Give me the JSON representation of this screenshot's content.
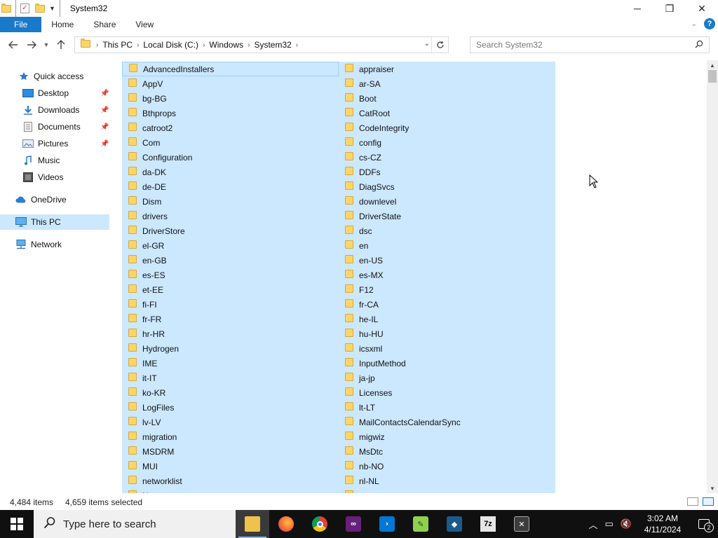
{
  "window": {
    "title": "System32",
    "controls": {
      "minimize": "─",
      "maximize": "❐",
      "close": "✕"
    }
  },
  "ribbon": {
    "tabs": [
      "File",
      "Home",
      "Share",
      "View"
    ]
  },
  "address": {
    "crumbs": [
      "This PC",
      "Local Disk (C:)",
      "Windows",
      "System32"
    ],
    "search_placeholder": "Search System32"
  },
  "nav": {
    "items": [
      {
        "label": "Quick access",
        "icon": "star-icon",
        "pinned": false
      },
      {
        "label": "Desktop",
        "icon": "desktop-icon",
        "pinned": true
      },
      {
        "label": "Downloads",
        "icon": "download-icon",
        "pinned": true
      },
      {
        "label": "Documents",
        "icon": "documents-icon",
        "pinned": true
      },
      {
        "label": "Pictures",
        "icon": "pictures-icon",
        "pinned": true
      },
      {
        "label": "Music",
        "icon": "music-icon",
        "pinned": false
      },
      {
        "label": "Videos",
        "icon": "videos-icon",
        "pinned": false
      },
      {
        "label": "OneDrive",
        "icon": "cloud-icon",
        "pinned": false
      },
      {
        "label": "This PC",
        "icon": "computer-icon",
        "pinned": false,
        "selected": true
      },
      {
        "label": "Network",
        "icon": "network-icon",
        "pinned": false
      }
    ]
  },
  "files": {
    "column_a": [
      "AdvancedInstallers",
      "AppV",
      "bg-BG",
      "Bthprops",
      "catroot2",
      "Com",
      "Configuration",
      "da-DK",
      "de-DE",
      "Dism",
      "drivers",
      "DriverStore",
      "el-GR",
      "en-GB",
      "es-ES",
      "et-EE",
      "fi-FI",
      "fr-FR",
      "hr-HR",
      "Hydrogen",
      "IME",
      "it-IT",
      "ko-KR",
      "LogFiles",
      "lv-LV",
      "migration",
      "MSDRM",
      "MUI",
      "networklist",
      "Ns"
    ],
    "column_b": [
      "appraiser",
      "ar-SA",
      "Boot",
      "CatRoot",
      "CodeIntegrity",
      "config",
      "cs-CZ",
      "DDFs",
      "DiagSvcs",
      "downlevel",
      "DriverState",
      "dsc",
      "en",
      "en-US",
      "es-MX",
      "F12",
      "fr-CA",
      "he-IL",
      "hu-HU",
      "icsxml",
      "InputMethod",
      "ja-jp",
      "Licenses",
      "lt-LT",
      "MailContactsCalendarSync",
      "migwiz",
      "MsDtc",
      "nb-NO",
      "nl-NL",
      "oo"
    ]
  },
  "status": {
    "item_count": "4,484 items",
    "selected_count": "4,659 items selected"
  },
  "taskbar": {
    "search_placeholder": "Type here to search",
    "apps": [
      {
        "name": "file-explorer-icon",
        "active": true
      },
      {
        "name": "firefox-icon",
        "active": false
      },
      {
        "name": "chrome-icon",
        "active": false
      },
      {
        "name": "visual-studio-icon",
        "active": false
      },
      {
        "name": "vscode-icon",
        "active": false
      },
      {
        "name": "notepad-plus-plus-icon",
        "active": false
      },
      {
        "name": "virtualbox-icon",
        "active": false
      },
      {
        "name": "7zip-icon",
        "active": false
      },
      {
        "name": "terminal-icon",
        "active": false
      }
    ],
    "clock_time": "3:02 AM",
    "clock_date": "4/11/2024",
    "notification_count": "2"
  },
  "colors": {
    "accent": "#1979ca",
    "selection": "#cce8ff",
    "taskbar": "#101010"
  }
}
